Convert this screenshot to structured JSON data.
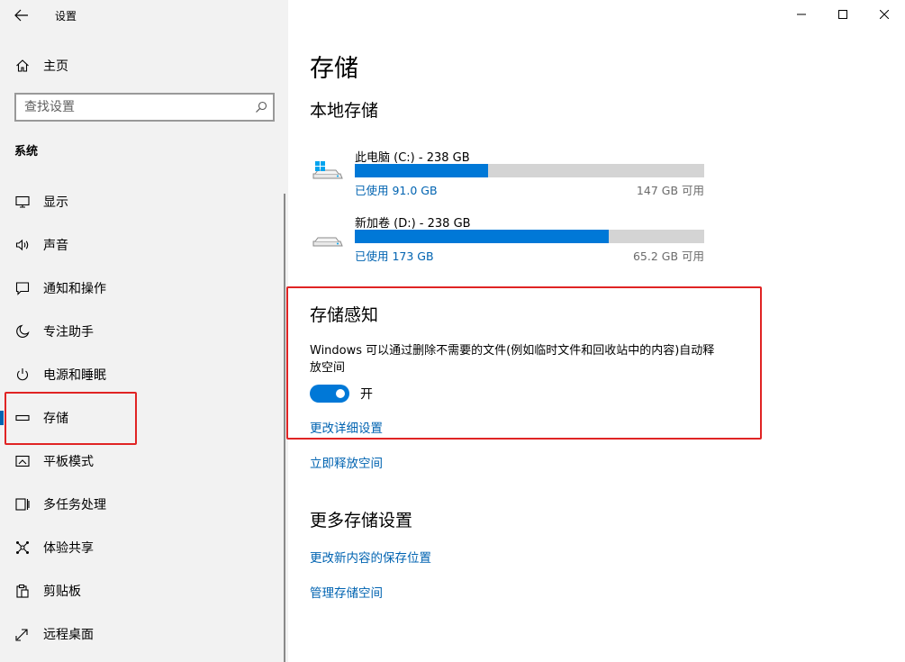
{
  "app_title": "设置",
  "home_label": "主页",
  "search": {
    "placeholder": "查找设置"
  },
  "section_label": "系统",
  "nav": [
    {
      "label": "显示",
      "icon": "monitor-icon"
    },
    {
      "label": "声音",
      "icon": "speaker-icon"
    },
    {
      "label": "通知和操作",
      "icon": "notification-icon"
    },
    {
      "label": "专注助手",
      "icon": "moon-icon"
    },
    {
      "label": "电源和睡眠",
      "icon": "power-icon"
    },
    {
      "label": "存储",
      "icon": "storage-icon",
      "selected": true
    },
    {
      "label": "平板模式",
      "icon": "tablet-icon"
    },
    {
      "label": "多任务处理",
      "icon": "multitask-icon"
    },
    {
      "label": "体验共享",
      "icon": "share-icon"
    },
    {
      "label": "剪贴板",
      "icon": "clipboard-icon"
    },
    {
      "label": "远程桌面",
      "icon": "remote-desktop-icon"
    }
  ],
  "main": {
    "title": "存储",
    "local_storage_heading": "本地存储",
    "drives": [
      {
        "name": "此电脑 (C:) - 238 GB",
        "used": "已使用 91.0 GB",
        "free": "147 GB 可用",
        "used_fraction": 0.382,
        "icon": "windows-drive-icon"
      },
      {
        "name": "新加卷 (D:) - 238 GB",
        "used": "已使用 173 GB",
        "free": "65.2 GB 可用",
        "used_fraction": 0.726,
        "icon": "drive-icon"
      }
    ],
    "storage_sense": {
      "heading": "存储感知",
      "description": "Windows 可以通过删除不需要的文件(例如临时文件和回收站中的内容)自动释放空间",
      "toggle_state": "开",
      "toggle_on": true,
      "change_link": "更改详细设置"
    },
    "free_now_link": "立即释放空间",
    "more_heading": "更多存储设置",
    "more_links": [
      "更改新内容的保存位置",
      "管理存储空间"
    ]
  },
  "colors": {
    "accent": "#0078d7",
    "link": "#0063b1",
    "highlight": "#e02424",
    "sidebar_bg": "#f2f2f2"
  }
}
